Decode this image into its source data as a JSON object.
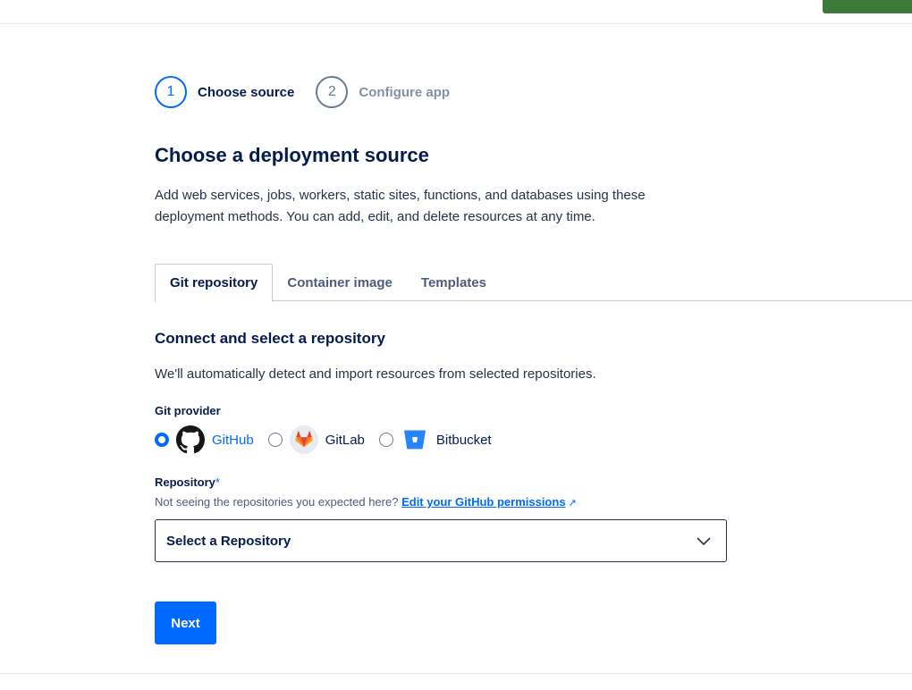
{
  "header": {
    "action_color": "#3c7a3a"
  },
  "stepper": {
    "steps": [
      {
        "number": "1",
        "label": "Choose source",
        "active": true
      },
      {
        "number": "2",
        "label": "Configure app",
        "active": false
      }
    ]
  },
  "page": {
    "title": "Choose a deployment source",
    "description": "Add web services, jobs, workers, static sites, functions, and databases using these deployment methods. You can add, edit, and delete resources at any time."
  },
  "tabs": [
    {
      "label": "Git repository",
      "active": true
    },
    {
      "label": "Container image",
      "active": false
    },
    {
      "label": "Templates",
      "active": false
    }
  ],
  "section": {
    "title": "Connect and select a repository",
    "description": "We'll automatically detect and import resources from selected repositories."
  },
  "git_provider": {
    "label": "Git provider",
    "options": [
      {
        "label": "GitHub",
        "icon": "github-icon",
        "selected": true
      },
      {
        "label": "GitLab",
        "icon": "gitlab-icon",
        "selected": false
      },
      {
        "label": "Bitbucket",
        "icon": "bitbucket-icon",
        "selected": false
      }
    ]
  },
  "repository": {
    "label": "Repository",
    "required_mark": "*",
    "hint": "Not seeing the repositories you expected here?",
    "hint_link": "Edit your GitHub permissions",
    "select_value": "Select a Repository"
  },
  "actions": {
    "next_label": "Next"
  },
  "colors": {
    "primary": "#0069ff",
    "text": "#031b4e",
    "muted": "#8690a2"
  }
}
